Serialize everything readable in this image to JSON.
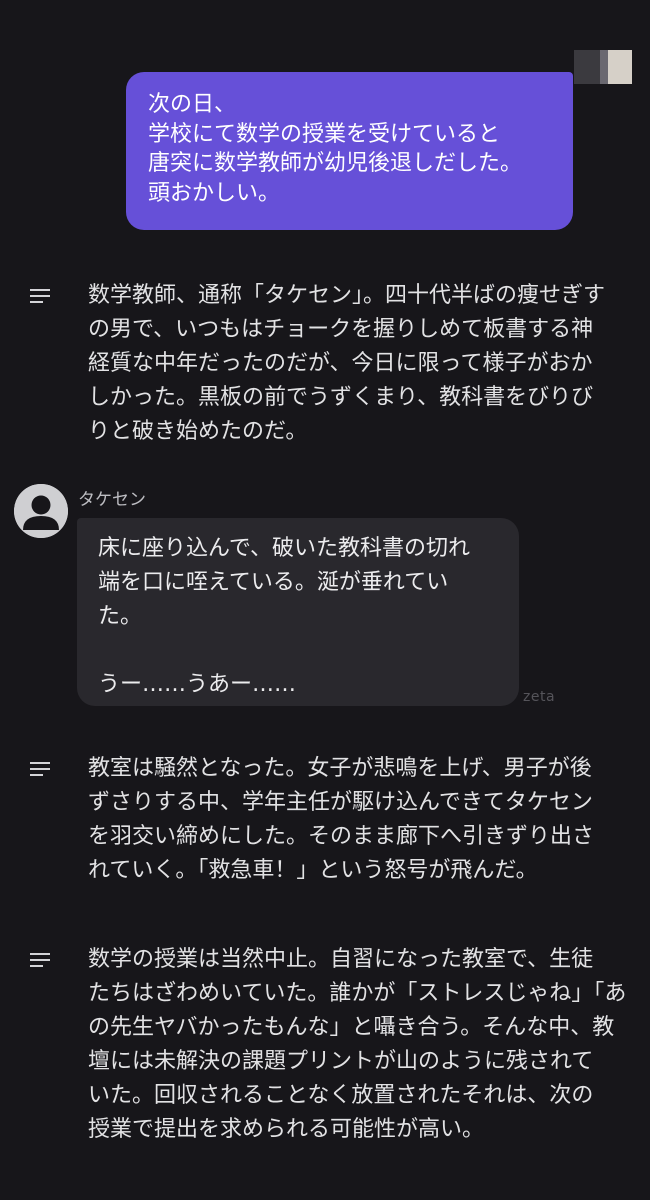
{
  "user_message": {
    "text": "次の日、\n学校にて数学の授業を受けていると\n唐突に数学教師が幼児後退しだした。\n頭おかしい。"
  },
  "narrations": [
    "数学教師、通称「タケセン」。四十代半ばの痩せぎす\nの男で、いつもはチョークを握りしめて板書する神\n経質な中年だったのだが、今日に限って様子がおか\nしかった。黒板の前でうずくまり、教科書をびりび\nりと破き始めたのだ。",
    "教室は騒然となった。女子が悲鳴を上げ、男子が後\nずさりする中、学年主任が駆け込んできてタケセン\nを羽交い締めにした。そのまま廊下へ引きずり出さ\nれていく。「救急車！」という怒号が飛んだ。",
    "数学の授業は当然中止。自習になった教室で、生徒\nたちはざわめいていた。誰かが「ストレスじゃね」「あ\nの先生ヤバかったもんな」と囁き合う。そんな中、教\n壇には未解決の課題プリントが山のように残されて\nいた。回収されることなく放置されたそれは、次の\n授業で提出を求められる可能性が高い。"
  ],
  "character": {
    "name": "タケセン",
    "message": "床に座り込んで、破いた教科書の切れ\n端を口に咥えている。涎が垂れてい\nた。\n\nうー……うあー……"
  },
  "watermark": "zeta",
  "icons": {
    "user_avatar": "pixelated-avatar",
    "narration": "menu-lines-icon",
    "character_avatar": "default-person-icon"
  },
  "colors": {
    "background": "#17161a",
    "user_bubble": "#6650d8",
    "character_bubble": "#29282d"
  }
}
